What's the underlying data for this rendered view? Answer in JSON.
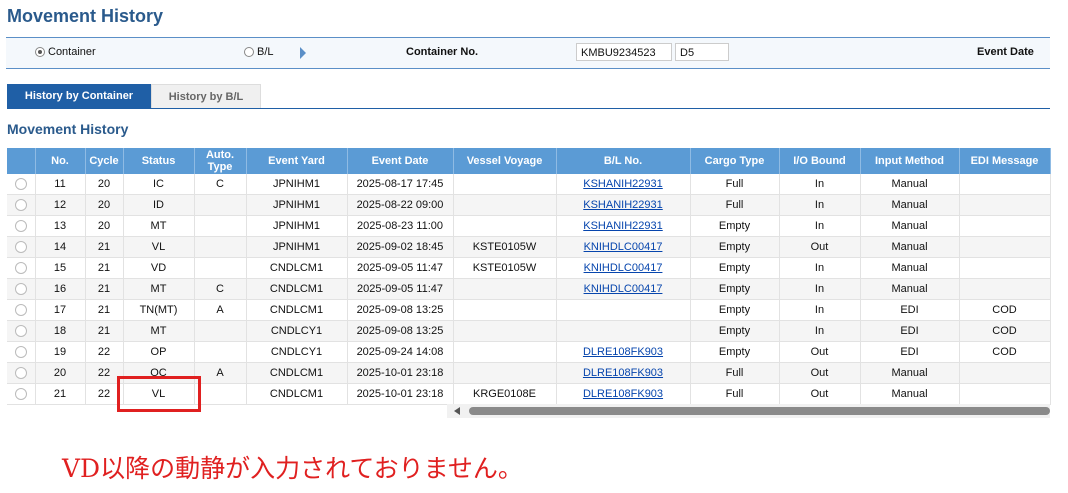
{
  "page_title": "Movement History",
  "search": {
    "radio_container": "Container",
    "radio_bl": "B/L",
    "container_no_label": "Container No.",
    "container_no_value": "KMBU9234523",
    "check_digit_value": "D5",
    "event_date_label": "Event Date"
  },
  "tabs": [
    "History by Container",
    "History by B/L"
  ],
  "section_title": "Movement History",
  "columns": [
    "",
    "No.",
    "Cycle",
    "Status",
    "Auto.\nType",
    "Event Yard",
    "Event Date",
    "Vessel Voyage",
    "B/L No.",
    "Cargo Type",
    "I/O Bound",
    "Input Method",
    "EDI Message"
  ],
  "rows": [
    {
      "no": "11",
      "cycle": "20",
      "status": "IC",
      "auto": "C",
      "yard": "JPNIHM1",
      "date": "2025-08-17 17:45",
      "vessel": "",
      "bl": "KSHANIH22931",
      "cargo": "Full",
      "io": "In",
      "method": "Manual",
      "edi": ""
    },
    {
      "no": "12",
      "cycle": "20",
      "status": "ID",
      "auto": "",
      "yard": "JPNIHM1",
      "date": "2025-08-22 09:00",
      "vessel": "",
      "bl": "KSHANIH22931",
      "cargo": "Full",
      "io": "In",
      "method": "Manual",
      "edi": ""
    },
    {
      "no": "13",
      "cycle": "20",
      "status": "MT",
      "auto": "",
      "yard": "JPNIHM1",
      "date": "2025-08-23 11:00",
      "vessel": "",
      "bl": "KSHANIH22931",
      "cargo": "Empty",
      "io": "In",
      "method": "Manual",
      "edi": ""
    },
    {
      "no": "14",
      "cycle": "21",
      "status": "VL",
      "auto": "",
      "yard": "JPNIHM1",
      "date": "2025-09-02 18:45",
      "vessel": "KSTE0105W",
      "bl": "KNIHDLC00417",
      "cargo": "Empty",
      "io": "Out",
      "method": "Manual",
      "edi": ""
    },
    {
      "no": "15",
      "cycle": "21",
      "status": "VD",
      "auto": "",
      "yard": "CNDLCM1",
      "date": "2025-09-05 11:47",
      "vessel": "KSTE0105W",
      "bl": "KNIHDLC00417",
      "cargo": "Empty",
      "io": "In",
      "method": "Manual",
      "edi": ""
    },
    {
      "no": "16",
      "cycle": "21",
      "status": "MT",
      "auto": "C",
      "yard": "CNDLCM1",
      "date": "2025-09-05 11:47",
      "vessel": "",
      "bl": "KNIHDLC00417",
      "cargo": "Empty",
      "io": "In",
      "method": "Manual",
      "edi": ""
    },
    {
      "no": "17",
      "cycle": "21",
      "status": "TN(MT)",
      "auto": "A",
      "yard": "CNDLCM1",
      "date": "2025-09-08 13:25",
      "vessel": "",
      "bl": "",
      "cargo": "Empty",
      "io": "In",
      "method": "EDI",
      "edi": "COD"
    },
    {
      "no": "18",
      "cycle": "21",
      "status": "MT",
      "auto": "",
      "yard": "CNDLCY1",
      "date": "2025-09-08 13:25",
      "vessel": "",
      "bl": "",
      "cargo": "Empty",
      "io": "In",
      "method": "EDI",
      "edi": "COD"
    },
    {
      "no": "19",
      "cycle": "22",
      "status": "OP",
      "auto": "",
      "yard": "CNDLCY1",
      "date": "2025-09-24 14:08",
      "vessel": "",
      "bl": "DLRE108FK903",
      "cargo": "Empty",
      "io": "Out",
      "method": "EDI",
      "edi": "COD"
    },
    {
      "no": "20",
      "cycle": "22",
      "status": "OC",
      "auto": "A",
      "yard": "CNDLCM1",
      "date": "2025-10-01 23:18",
      "vessel": "",
      "bl": "DLRE108FK903",
      "cargo": "Full",
      "io": "Out",
      "method": "Manual",
      "edi": ""
    },
    {
      "no": "21",
      "cycle": "22",
      "status": "VL",
      "auto": "",
      "yard": "CNDLCM1",
      "date": "2025-10-01 23:18",
      "vessel": "KRGE0108E",
      "bl": "DLRE108FK903",
      "cargo": "Full",
      "io": "Out",
      "method": "Manual",
      "edi": ""
    }
  ],
  "annotation_note": "VD以降の動静が入力されておりません。",
  "colors": {
    "accent": "#1f5fa6",
    "header": "#5b9bd5",
    "highlight": "#e02020"
  }
}
